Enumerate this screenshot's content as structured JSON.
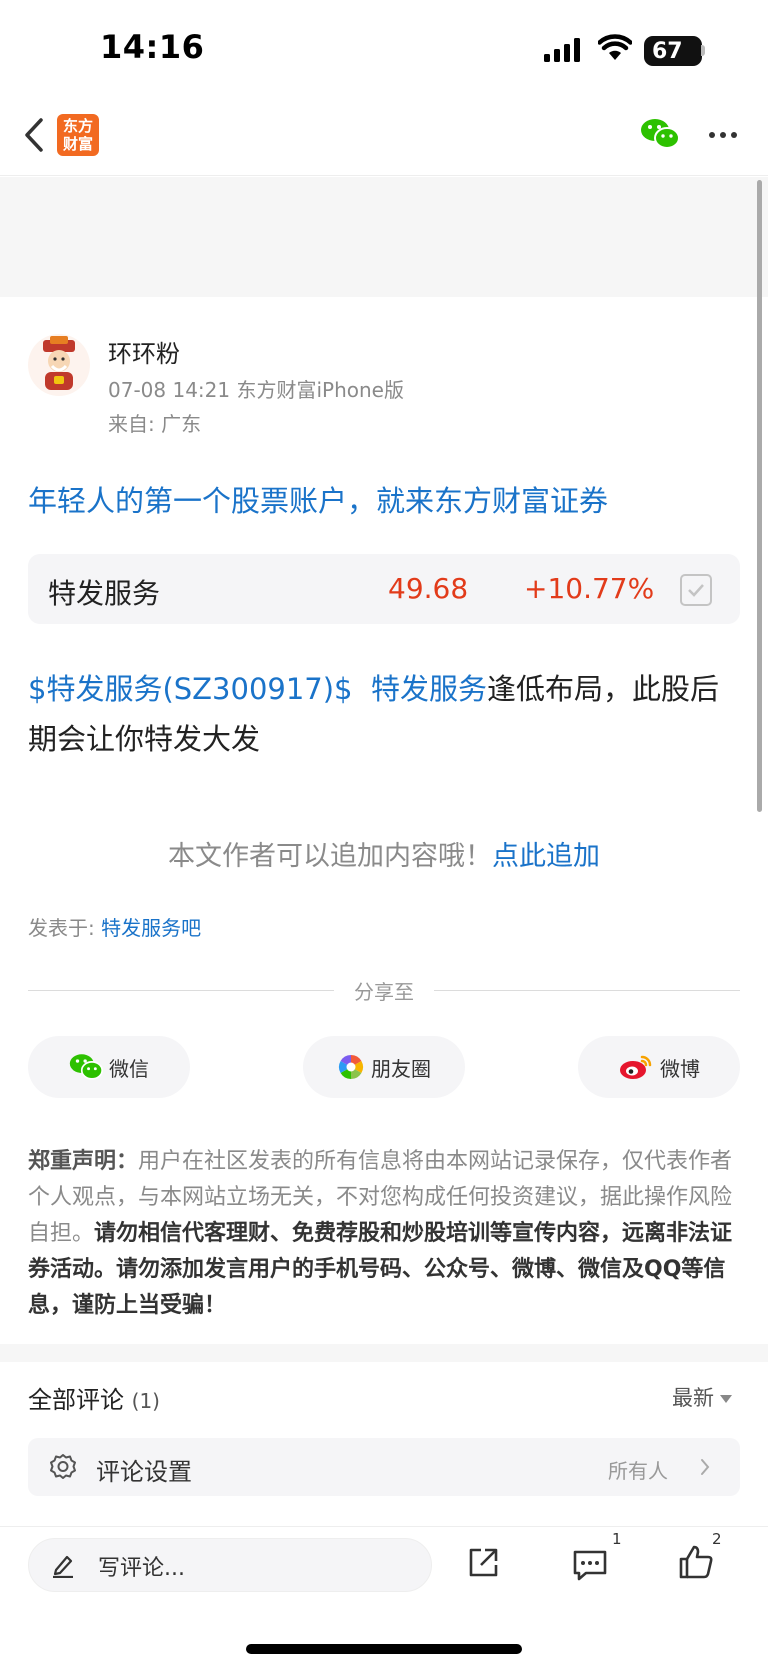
{
  "status_bar": {
    "time": "14:16",
    "battery": "67"
  },
  "nav": {
    "logo_line1": "东方",
    "logo_line2": "财富"
  },
  "author": {
    "name": "环环粉",
    "meta": "07-08 14:21 东方财富iPhone版",
    "origin": "来自: 广东"
  },
  "promo": "年轻人的第一个股票账户，就来东方财富证券",
  "stock": {
    "name": "特发服务",
    "price": "49.68",
    "change": "+10.77%"
  },
  "post": {
    "tag": "$特发服务(SZ300917)$",
    "link": "特发服务",
    "text": "逢低布局，此股后期会让你特发大发"
  },
  "append": {
    "text": "本文作者可以追加内容哦！",
    "link": "点此追加"
  },
  "forum": {
    "label": "发表于: ",
    "link": "特发服务吧"
  },
  "share": {
    "title": "分享至",
    "wechat": "微信",
    "moments": "朋友圈",
    "weibo": "微博"
  },
  "disclaimer": {
    "lead": "郑重声明：",
    "normal": "用户在社区发表的所有信息将由本网站记录保存，仅代表作者个人观点，与本网站立场无关，不对您构成任何投资建议，据此操作风险自担。",
    "strong": "请勿相信代客理财、免费荐股和炒股培训等宣传内容，远离非法证券活动。请勿添加发言用户的手机号码、公众号、微博、微信及QQ等信息，谨防上当受骗！"
  },
  "comments": {
    "title": "全部评论",
    "count": "(1)",
    "sort": "最新",
    "settings_label": "评论设置",
    "settings_value": "所有人"
  },
  "bottom_bar": {
    "write_placeholder": "写评论...",
    "comment_count": "1",
    "like_count": "2"
  },
  "colors": {
    "link": "#1a73c9",
    "up": "#e23b1a",
    "brand": "#f26a21"
  }
}
